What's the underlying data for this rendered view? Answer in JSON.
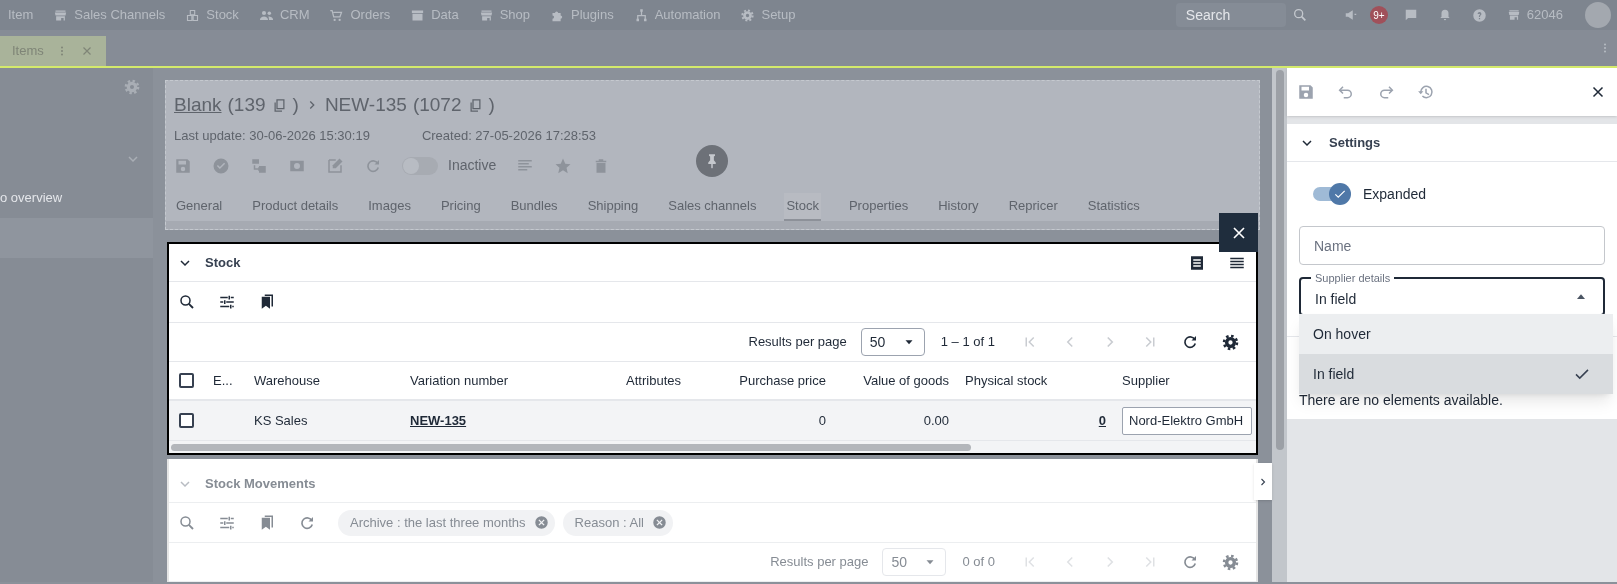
{
  "top_nav": {
    "items": [
      "Item",
      "Sales Channels",
      "Stock",
      "CRM",
      "Orders",
      "Data",
      "Shop",
      "Plugins",
      "Automation",
      "Setup"
    ],
    "search": {
      "placeholder": "Search"
    },
    "notification_badge": "9+",
    "account_number": "62046"
  },
  "tabs": [
    {
      "label": "Items",
      "selected": true
    }
  ],
  "sidebar": {
    "items": [
      "o overview"
    ]
  },
  "item_header": {
    "breadcrumb": [
      {
        "label": "Blank",
        "count": "(139",
        "count_end": ")"
      },
      {
        "label": "NEW-135",
        "count": "(1072",
        "count_end": ")"
      }
    ],
    "last_update": "Last update: 30-06-2026 15:30:19",
    "created": "Created: 27-05-2026 17:28:53",
    "active_toggle": {
      "on": false,
      "label": "Inactive"
    },
    "tabs": [
      {
        "label": "General",
        "selected": false
      },
      {
        "label": "Product details",
        "selected": false
      },
      {
        "label": "Images",
        "selected": false
      },
      {
        "label": "Pricing",
        "selected": false
      },
      {
        "label": "Bundles",
        "selected": false
      },
      {
        "label": "Shipping",
        "selected": false
      },
      {
        "label": "Sales channels",
        "selected": false
      },
      {
        "label": "Stock",
        "selected": true
      },
      {
        "label": "Properties",
        "selected": false
      },
      {
        "label": "History",
        "selected": false
      },
      {
        "label": "Repricer",
        "selected": false
      },
      {
        "label": "Statistics",
        "selected": false
      }
    ]
  },
  "stock": {
    "title": "Stock",
    "expanded": true,
    "pagination": {
      "label": "Results per page",
      "per_page": "50",
      "range": "1 – 1 of 1"
    },
    "select_all_checked": false,
    "columns": [
      "E...",
      "Warehouse",
      "Variation number",
      "Attributes",
      "Purchase price",
      "Value of goods",
      "Physical stock",
      "Supplier"
    ],
    "rows": [
      {
        "checked": false,
        "cells": {
          "warehouse": "KS Sales",
          "variation_number": "NEW-135",
          "purchase_price": "0",
          "value_of_goods": "0.00",
          "physical_stock": "0",
          "supplier": "Nord-Elektro GmbH"
        }
      }
    ]
  },
  "stock_movements": {
    "title": "Stock Movements",
    "expanded": true,
    "filters": [
      "Archive : the last three months",
      "Reason : All"
    ],
    "pagination": {
      "label": "Results per page",
      "per_page": "50",
      "range": "0 of 0"
    }
  },
  "settings_panel": {
    "title": "Settings",
    "expanded": true,
    "expanded_toggle": {
      "label": "Expanded",
      "on": true
    },
    "name_field": {
      "placeholder": "Name"
    },
    "supplier_details": {
      "label": "Supplier details",
      "value": "In field",
      "open": true,
      "options": [
        {
          "label": "On hover",
          "selected": false
        },
        {
          "label": "In field",
          "selected": true
        }
      ]
    },
    "empty_message": "There are no elements available."
  }
}
